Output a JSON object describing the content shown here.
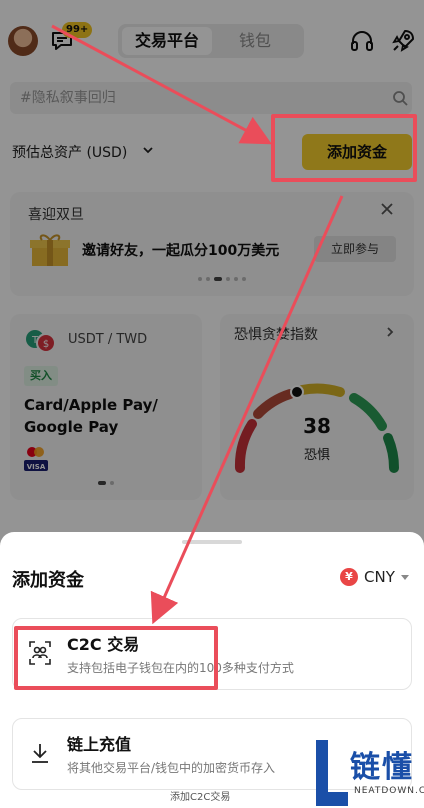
{
  "header": {
    "badge": "99+",
    "tabs": [
      {
        "label": "交易平台",
        "active": true
      },
      {
        "label": "钱包",
        "active": false
      }
    ]
  },
  "search": {
    "placeholder": "#隐私叙事回归"
  },
  "assets": {
    "label": "预估总资产 (USD)",
    "add_funds_button": "添加资金"
  },
  "promo": {
    "title": "喜迎双旦",
    "text": "邀请好友，一起瓜分100万美元",
    "join_button": "立即参与"
  },
  "p2p_card": {
    "pair": "USDT / TWD",
    "tag": "买入",
    "payment_methods": "Card/Apple Pay/ Google Pay",
    "logo_text": "VISA"
  },
  "fear_greed_card": {
    "title": "恐惧贪婪指数",
    "value": "38",
    "label": "恐惧",
    "index_value": 38
  },
  "sheet": {
    "title": "添加资金",
    "currency": "CNY",
    "currency_symbol": "¥",
    "options": [
      {
        "title": "C2C 交易",
        "description": "支持包括电子钱包在内的100多种支付方式"
      },
      {
        "title": "链上充值",
        "description": "将其他交易平台/钱包中的加密货币存入"
      }
    ]
  },
  "colors": {
    "accent": "#f6cf2e",
    "annotation": "#ea4d5a",
    "buy": "#1f8a46"
  },
  "watermark": {
    "name": "链懂",
    "domain": "NEATDOWN.COM",
    "bottom_text": "添加C2C交易"
  }
}
